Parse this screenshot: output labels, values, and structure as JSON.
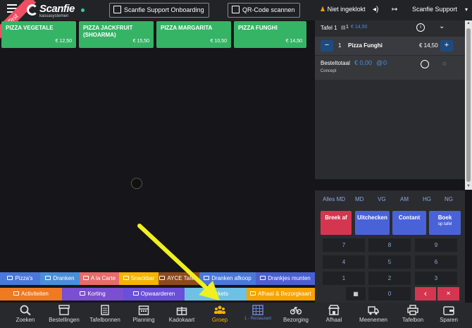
{
  "header": {
    "ribbon": "Test",
    "logo_name": "Scanfie",
    "logo_sub": "kassasystemen",
    "onboarding_label": "Scanfie Support Onboarding",
    "qr_label": "QR-Code scannen",
    "clock_status": "Niet ingeklokt",
    "user": "Scanfie Support"
  },
  "products": [
    {
      "name": "PIZZA VEGETALE",
      "price": "€ 12,50"
    },
    {
      "name": "PIZZA JACKFRUIT (SHOARMA)",
      "price": "€ 15,50"
    },
    {
      "name": "PIZZA MARGARITA",
      "price": "€ 10,50"
    },
    {
      "name": "PIZZA FUNGHI",
      "price": "€ 14,50"
    }
  ],
  "order": {
    "table": "Tafel 1",
    "table_count": "1",
    "table_amount": "€ 14,50",
    "line_qty": "1",
    "line_name": "Pizza Funghi",
    "line_price": "€ 14,50",
    "total_label": "Besteltotaal",
    "total_amount": "€ 0,00",
    "total_count": "0",
    "status": "Concept"
  },
  "keypad": {
    "filters": [
      "Alles MD",
      "MD",
      "VG",
      "AM",
      "HG",
      "NG"
    ],
    "breek_af": "Breek af",
    "uitchecken": "Uitchecken",
    "contant": "Contant",
    "boek": "Boek",
    "boek_sub": "op tafel",
    "numbers": [
      "7",
      "8",
      "9",
      "4",
      "5",
      "6",
      "1",
      "2",
      "3",
      "0"
    ],
    "back": "‹",
    "clear": "×"
  },
  "categories_row1": [
    {
      "label": "Pizza's",
      "color": "#4a78d8"
    },
    {
      "label": "Dranken",
      "color": "#4a8fd8"
    },
    {
      "label": "A la Carte",
      "color": "#e86a6a"
    },
    {
      "label": "Snackbar",
      "color": "#f5b400"
    },
    {
      "label": "AYCE Tafels",
      "color": "#8b4a1e"
    },
    {
      "label": "Dranken afkoop",
      "color": "#4a78d8"
    },
    {
      "label": "Drankjes munten",
      "color": "#4a60d0"
    }
  ],
  "categories_row2": [
    {
      "label": "Activiteiten",
      "color": "#ef7a22"
    },
    {
      "label": "Korting",
      "color": "#7a4fd0"
    },
    {
      "label": "Opwaarderen",
      "color": "#6a4fd8"
    },
    {
      "label": "Tickets",
      "color": "#6ec1e4"
    },
    {
      "label": "Afhaal & Bezorgkaart",
      "color": "#f5a400"
    }
  ],
  "nav": [
    {
      "label": "Zoeken",
      "icon": "search-icon"
    },
    {
      "label": "Bestellingen",
      "icon": "archive-icon"
    },
    {
      "label": "Tafelbonnen",
      "icon": "receipt-icon"
    },
    {
      "label": "Planning",
      "icon": "calendar-icon"
    },
    {
      "label": "Kadokaart",
      "icon": "gift-icon"
    },
    {
      "label": "Groep",
      "icon": "group-icon"
    },
    {
      "label": "1 - Restaurant",
      "icon": "grid-icon"
    },
    {
      "label": "Bezorging",
      "icon": "bike-icon"
    },
    {
      "label": "Afhaal",
      "icon": "store-icon"
    },
    {
      "label": "Meenemen",
      "icon": "truck-icon"
    },
    {
      "label": "Tafelbon",
      "icon": "printer-icon"
    },
    {
      "label": "Sparen",
      "icon": "wallet-icon"
    }
  ],
  "colors": {
    "accent_green": "#35b465",
    "accent_yellow": "#f5b400",
    "panel": "#2b2c30",
    "danger": "#d4364f",
    "primary": "#4a62d8"
  }
}
